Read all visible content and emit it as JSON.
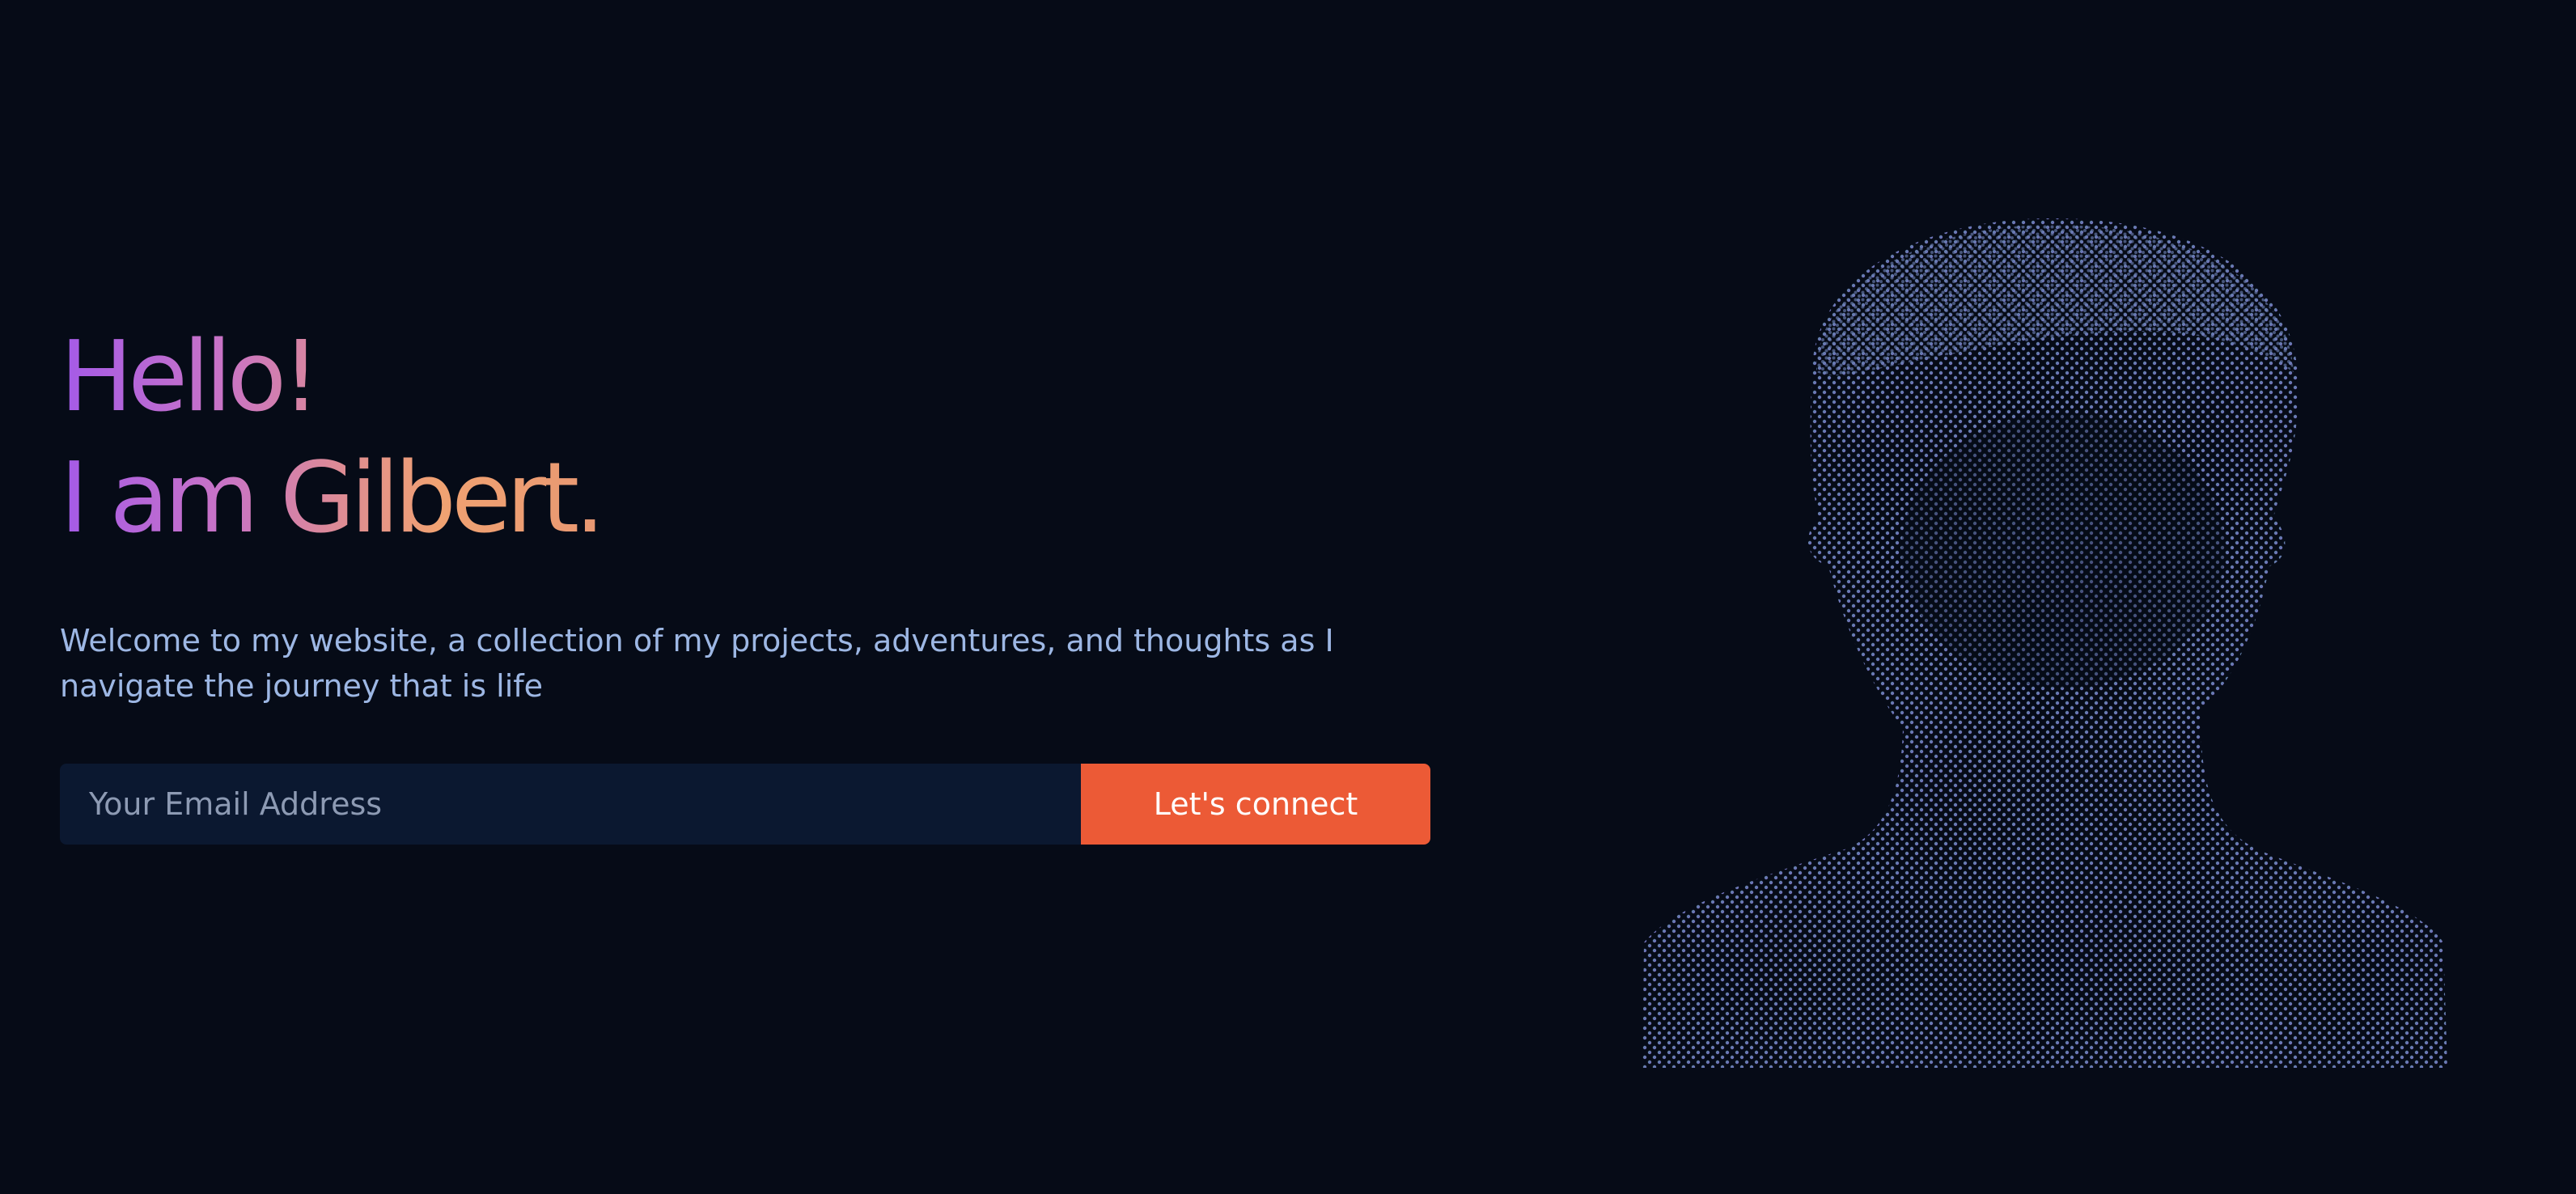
{
  "hero": {
    "greeting_line1": "Hello!",
    "greeting_line2": "I am Gilbert.",
    "intro": "Welcome to my website, a collection of my projects, adventures, and thoughts as I navigate the journey that is life"
  },
  "form": {
    "email_placeholder": "Your Email Address",
    "email_value": "",
    "connect_label": "Let's connect"
  },
  "portrait": {
    "icon": "dotted-head-silhouette"
  },
  "colors": {
    "background": "#060b17",
    "gradient_start": "#a45ae8",
    "gradient_end": "#f0a272",
    "intro_text": "#9db7e4",
    "input_background": "#0b1830",
    "button": "#ec5a36",
    "dots_start": "#5f8aa6",
    "dots_end": "#7f6fc8"
  }
}
